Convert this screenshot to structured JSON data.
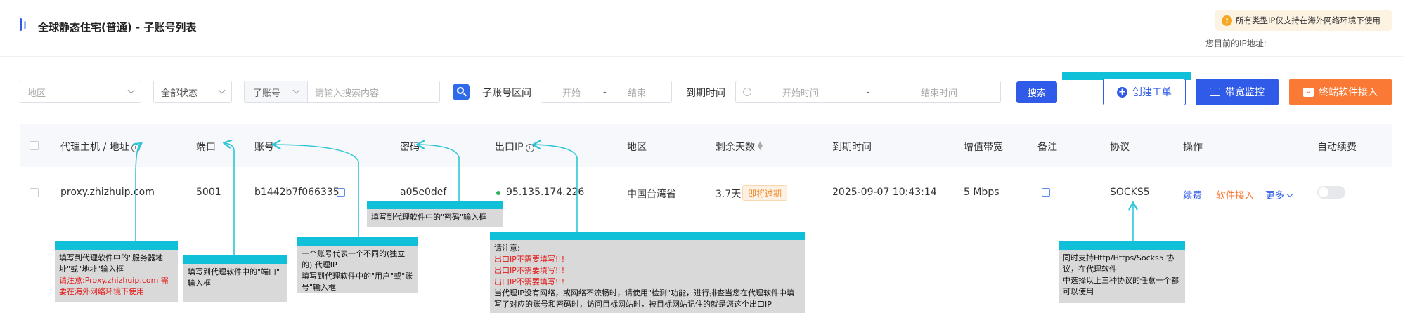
{
  "header": {
    "title": "全球静态住宅(普通) - 子账号列表",
    "notice": "所有类型IP仅支持在海外网络环境下使用",
    "current_ip_label": "您目前的IP地址:"
  },
  "filters": {
    "region_placeholder": "地区",
    "status_value": "全部状态",
    "subaccount_prefix": "子账号",
    "search_placeholder": "请输入搜索内容",
    "range_label": "子账号区间",
    "range_start": "开始",
    "range_sep": "-",
    "range_end": "结束",
    "expiry_label": "到期时间",
    "expiry_start": "开始时间",
    "expiry_sep": "-",
    "expiry_end": "结束时间",
    "search_button": "搜索"
  },
  "actions": {
    "create_ticket": "创建工单",
    "bandwidth_monitor": "带宽监控",
    "terminal_access": "终端软件接入"
  },
  "table": {
    "columns": {
      "host": "代理主机 / 地址",
      "port": "端口",
      "account": "账号",
      "password": "密码",
      "exit_ip": "出口IP",
      "region": "地区",
      "days_left": "剩余天数",
      "expiry": "到期时间",
      "bandwidth": "增值带宽",
      "remark": "备注",
      "protocol": "协议",
      "ops": "操作",
      "auto_renew": "自动续费"
    },
    "rows": [
      {
        "host": "proxy.zhizhuip.com",
        "port": "5001",
        "account": "b1442b7f066335",
        "password": "a05e0def",
        "exit_ip": "95.135.174.226",
        "region": "中国台湾省",
        "days_left": "3.7天",
        "days_tag": "即将过期",
        "expiry": "2025-09-07 10:43:14",
        "bandwidth": "5 Mbps",
        "protocol": "SOCKS5",
        "op_renew": "续费",
        "op_software": "软件接入",
        "op_more": "更多"
      }
    ]
  },
  "annotations": {
    "host": {
      "line1": "填写到代理软件中的\"服务器地",
      "line2": "址\"或\"地址\"输入框",
      "red1": "请注意:Proxy.zhizhuip.com 需",
      "red2": "要在海外网络环境下使用"
    },
    "port": {
      "line1": "填写到代理软件中的\"端口\"",
      "line2": "输入框"
    },
    "account": {
      "line1": "一个账号代表一个不同的(独立",
      "line2": "的) 代理IP",
      "line3": "填写到代理软件中的\"用户\"或\"账",
      "line4": "号\"输入框"
    },
    "password": {
      "line1": "填写到代理软件中的\"密码\"输入框"
    },
    "exit_ip": {
      "title": "请注意:",
      "red1": "出口IP不需要填写!!!",
      "red2": "出口IP不需要填写!!!",
      "red3": "出口IP不需要填写!!!",
      "line1": "当代理IP没有网络，或网络不流畅时，请使用\"检测\"功能，进行排查当您在代理软件中填",
      "line2": "写了对应的账号和密码时，访问目标网站时，被目标网站记住的就是您这个出口IP"
    },
    "protocol": {
      "line1": "同时支持Http/Https/Socks5 协",
      "line2": "议，在代理软件",
      "line3": "中选择以上三种协议的任意一个都",
      "line4": "可以使用"
    }
  },
  "colors": {
    "primary": "#2f5be8",
    "orange": "#fa7a35",
    "annotation_bar": "#0fc0d8",
    "annotation_bg": "#d9d9d9",
    "warning_red": "#e21b1b"
  }
}
